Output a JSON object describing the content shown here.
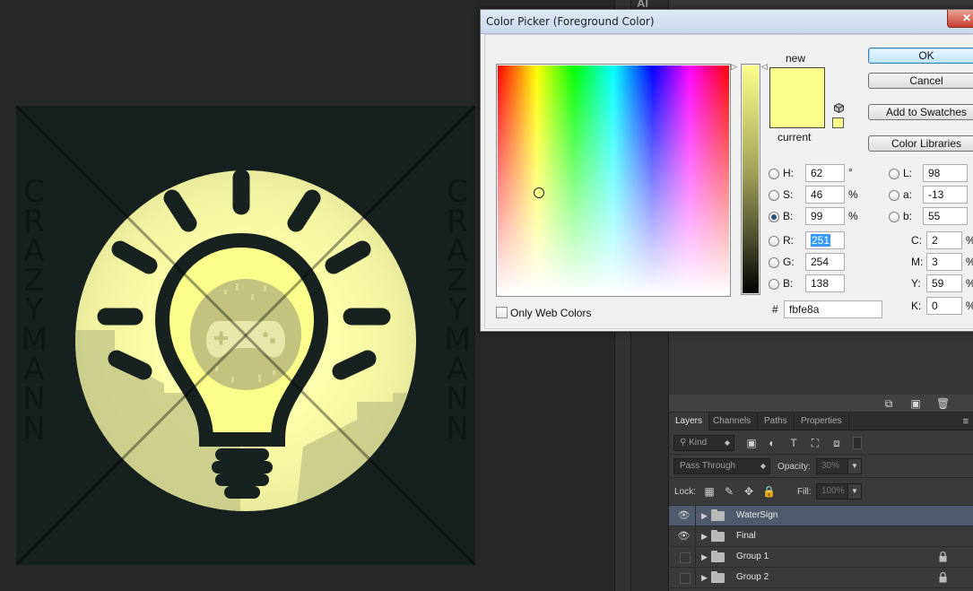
{
  "dialog": {
    "title": "Color Picker (Foreground Color)",
    "close_glyph": "✕",
    "new_label": "new",
    "current_label": "current",
    "new_color": "#fbfe8a",
    "current_color": "#fbfe8a",
    "buttons": {
      "ok": "OK",
      "cancel": "Cancel",
      "add_swatches": "Add to Swatches",
      "color_libraries": "Color Libraries"
    },
    "fields": {
      "h": {
        "label": "H:",
        "value": "62",
        "unit": "°"
      },
      "s": {
        "label": "S:",
        "value": "46",
        "unit": "%"
      },
      "b": {
        "label": "B:",
        "value": "99",
        "unit": "%"
      },
      "r": {
        "label": "R:",
        "value": "251"
      },
      "g": {
        "label": "G:",
        "value": "254"
      },
      "bl": {
        "label": "B:",
        "value": "138"
      },
      "l": {
        "label": "L:",
        "value": "98"
      },
      "a": {
        "label": "a:",
        "value": "-13"
      },
      "b2": {
        "label": "b:",
        "value": "55"
      },
      "c": {
        "label": "C:",
        "value": "2",
        "unit": "%"
      },
      "m": {
        "label": "M:",
        "value": "3",
        "unit": "%"
      },
      "y": {
        "label": "Y:",
        "value": "59",
        "unit": "%"
      },
      "k": {
        "label": "K:",
        "value": "0",
        "unit": "%"
      }
    },
    "hex_label": "#",
    "hex_value": "fbfe8a",
    "only_web_colors": "Only Web Colors"
  },
  "side": {
    "badge": "AI"
  },
  "artwork": {
    "watermark_left": [
      "C",
      "R",
      "A",
      "Z",
      "Y",
      "M",
      "A",
      "N",
      "N"
    ],
    "watermark_right": [
      "C",
      "R",
      "A",
      "Z",
      "Y",
      "M",
      "A",
      "N",
      "N"
    ]
  },
  "layers_panel": {
    "tabs": [
      "Layers",
      "Channels",
      "Paths",
      "Properties"
    ],
    "active_tab": "Layers",
    "menu_glyph": "≡",
    "filter_kind": "Kind",
    "blend_mode": "Pass Through",
    "opacity_label": "Opacity:",
    "opacity_value": "30%",
    "lock_label": "Lock:",
    "fill_label": "Fill:",
    "fill_value": "100%",
    "layers": [
      {
        "name": "WaterSign",
        "visible": true,
        "selected": true,
        "locked": false
      },
      {
        "name": "Final",
        "visible": true,
        "selected": false,
        "locked": false
      },
      {
        "name": "Group 1",
        "visible": false,
        "selected": false,
        "locked": true
      },
      {
        "name": "Group 2",
        "visible": false,
        "selected": false,
        "locked": true
      }
    ]
  }
}
